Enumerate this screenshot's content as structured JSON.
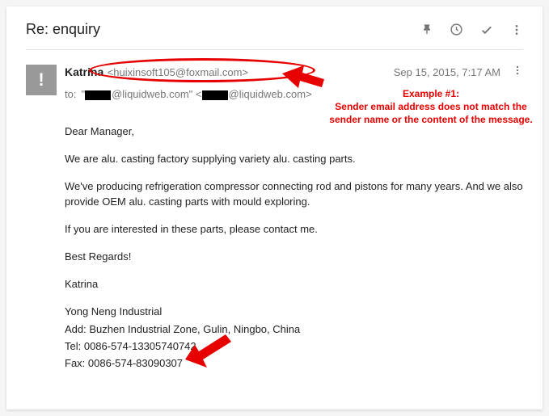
{
  "subject": "Re: enquiry",
  "sender": {
    "name": "Katrina",
    "email": "<huixinsoft105@foxmail.com>"
  },
  "date": "Sep 15, 2015, 7:17 AM",
  "to": {
    "label": "to:",
    "domain1": "@liquidweb.com\"",
    "domain2": "@liquidweb.com>"
  },
  "body": {
    "greeting": "Dear Manager,",
    "p1": "We are alu. casting factory supplying variety alu. casting parts.",
    "p2": "We've producing refrigeration compressor connecting rod and pistons for many years. And we also provide OEM alu. casting parts with mould exploring.",
    "p3": "If you are interested in these parts, please contact me.",
    "closing": "Best Regards!",
    "sig_name": "Katrina",
    "company": "Yong Neng Industrial",
    "addr": "Add: Buzhen Industrial Zone, Gulin, Ningbo, China",
    "tel": "Tel: 0086-574-13305740742",
    "fax": "Fax: 0086-574-83090307"
  },
  "annotation": {
    "title": "Example #1:",
    "desc": "Sender email address does not match the sender name or the content of the message."
  }
}
